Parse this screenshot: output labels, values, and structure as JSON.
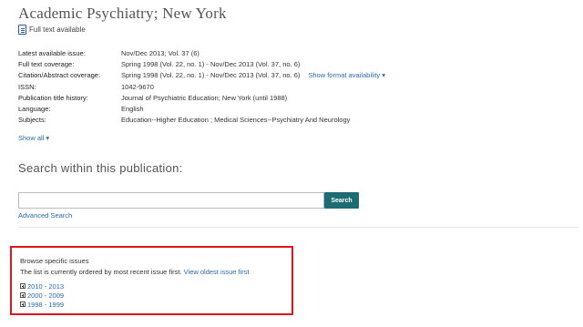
{
  "publication": {
    "title": "Academic Psychiatry; New York",
    "full_text_label": "Full text available"
  },
  "details": [
    {
      "label": "Latest available issue:",
      "value": "Nov/Dec 2013; Vol. 37 (6)",
      "is_link": true
    },
    {
      "label": "Full text coverage:",
      "value": "Spring 1998 (Vol. 22, no. 1) - Nov/Dec 2013 (Vol. 37, no. 6)",
      "is_link": false
    },
    {
      "label": "Citation/Abstract coverage:",
      "value": "Spring 1998 (Vol. 22, no. 1) - Nov/Dec 2013 (Vol. 37, no. 6)",
      "is_link": false,
      "extra_link": "Show format availability ▾"
    },
    {
      "label": "ISSN:",
      "value": "1042-9670",
      "is_link": false
    },
    {
      "label": "Publication title history:",
      "value": "Journal of Psychiatric Education; New York (until 1988)",
      "is_link": false
    },
    {
      "label": "Language:",
      "value": "English",
      "is_link": false
    },
    {
      "label": "Subjects:",
      "value": "Education--Higher Education ; Medical Sciences--Psychiatry And Neurology",
      "is_link": true
    }
  ],
  "show_all_label": "Show all ▾",
  "search": {
    "title": "Search within this publication:",
    "input_value": "",
    "button_label": "Search",
    "advanced_label": "Advanced Search"
  },
  "browse": {
    "heading": "Browse specific issues",
    "order_text": "The list is currently ordered by most recent issue first.",
    "order_link": "View oldest issue first",
    "year_ranges": [
      "2010 - 2013",
      "2000 - 2009",
      "1998 - 1999"
    ]
  },
  "colors": {
    "link": "#2a6ab0",
    "search_button": "#1d6b73",
    "highlight_box": "#e3141b"
  }
}
